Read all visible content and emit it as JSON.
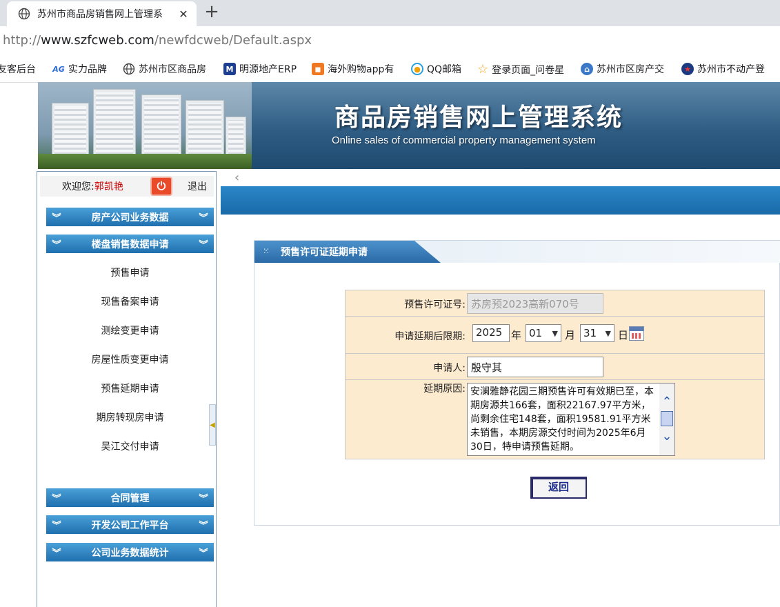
{
  "browser": {
    "tab_title": "苏州市商品房销售网上管理系",
    "url_scheme": "http://",
    "url_host": "www.szfcweb.com",
    "url_path": "/newfdcweb/Default.aspx",
    "bookmarks": [
      {
        "label": "友客后台",
        "icon": "page-icon",
        "color": "#ffffff"
      },
      {
        "label": "实力品牌",
        "icon": "brand-icon",
        "color": "#2b6bd6"
      },
      {
        "label": "苏州市区商品房",
        "icon": "globe-icon",
        "color": "#555555"
      },
      {
        "label": "明源地产ERP",
        "icon": "m-logo-icon",
        "color": "#1c3f91"
      },
      {
        "label": "海外购物app有",
        "icon": "shop-icon",
        "color": "#f07820"
      },
      {
        "label": "QQ邮箱",
        "icon": "qq-mail-icon",
        "color": "#2aa0e0"
      },
      {
        "label": "登录页面_问卷星",
        "icon": "star-icon",
        "color": "#f5a623"
      },
      {
        "label": "苏州市区房产交",
        "icon": "house-icon",
        "color": "#3b78c8"
      },
      {
        "label": "苏州市不动产登",
        "icon": "emblem-icon",
        "color": "#1b3a80"
      }
    ]
  },
  "banner": {
    "title": "商品房销售网上管理系统",
    "subtitle": "Online sales of commercial property management system"
  },
  "sidebar": {
    "welcome_label": "欢迎您:",
    "user_name": "郭凯艳",
    "logout": "退出",
    "menus": [
      {
        "label": "房产公司业务数据"
      },
      {
        "label": "楼盘销售数据申请"
      },
      {
        "label": "合同管理"
      },
      {
        "label": "开发公司工作平台"
      },
      {
        "label": "公司业务数据统计"
      }
    ],
    "sub_items": [
      {
        "label": "预售申请"
      },
      {
        "label": "现售备案申请"
      },
      {
        "label": "测绘变更申请"
      },
      {
        "label": "房屋性质变更申请"
      },
      {
        "label": "预售延期申请"
      },
      {
        "label": "期房转现房申请"
      },
      {
        "label": "吴江交付申请"
      }
    ]
  },
  "panel": {
    "title": "预售许可证延期申请"
  },
  "form": {
    "license_label": "预售许可证号:",
    "license_value": "苏房预2023高新070号",
    "deadline_label": "申请延期后限期:",
    "year_value": "2025",
    "year_unit": "年",
    "month_value": "01",
    "month_unit": "月",
    "day_value": "31",
    "day_unit": "日",
    "applicant_label": "申请人:",
    "applicant_value": "殷守其",
    "reason_label": "延期原因:",
    "reason_value": "安澜雅静花园三期预售许可有效期已至，本期房源共166套，面积22167.97平方米，尚剩余住宅148套，面积19581.91平方米未销售，本期房源交付时间为2025年6月30日，特申请预售延期。",
    "back_button": "返回"
  }
}
